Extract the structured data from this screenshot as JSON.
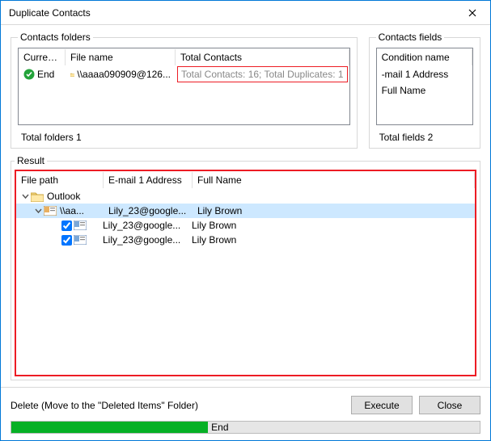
{
  "window": {
    "title": "Duplicate Contacts"
  },
  "folders": {
    "legend": "Contacts folders",
    "col_current": "Curren...",
    "col_filename": "File name",
    "col_total": "Total Contacts",
    "row_status": "End",
    "row_filename": "\\\\aaaa090909@126...",
    "summary": "Total Contacts: 16; Total Duplicates: 1",
    "totals": "Total folders  1"
  },
  "fields": {
    "legend": "Contacts fields",
    "col_condition": "Condition name",
    "items": [
      "-mail 1 Address",
      "Full Name"
    ],
    "totals": "Total fields  2"
  },
  "result": {
    "legend": "Result",
    "col_path": "File path",
    "col_email": "E-mail 1 Address",
    "col_name": "Full Name",
    "tree_root": "Outlook",
    "tree_sub": "\\\\aa...",
    "rows": [
      {
        "email": "Lily_23@google...",
        "name": "Lily Brown"
      },
      {
        "email": "Lily_23@google...",
        "name": "Lily Brown"
      },
      {
        "email": "Lily_23@google...",
        "name": "Lily Brown"
      }
    ]
  },
  "bottom": {
    "delete_label": "Delete (Move to the \"Deleted Items\" Folder)",
    "execute": "Execute",
    "close": "Close",
    "progress_text": "End"
  }
}
